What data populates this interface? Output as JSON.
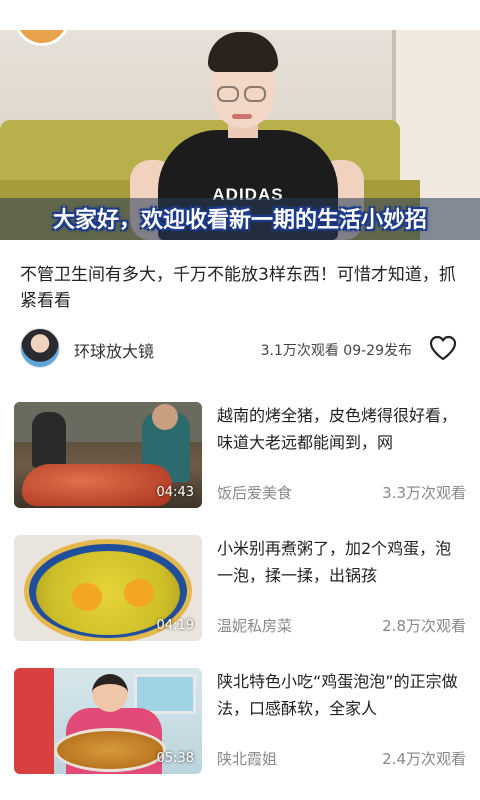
{
  "player": {
    "subtitle": "大家好，欢迎收看新一期的生活小妙招",
    "shirt_text": "ADIDAS",
    "progress_percent": 0
  },
  "video": {
    "title": "不管卫生间有多大，千万不能放3样东西！可惜才知道，抓紧看看",
    "author": "环球放大镜",
    "view_info": "3.1万次观看 09-29发布",
    "like_icon": "heart-outline-icon"
  },
  "recommendations": [
    {
      "title": "越南的烤全猪，皮色烤得很好看，味道大老远都能闻到，网",
      "duration": "04:43",
      "author": "饭后爱美食",
      "views": "3.3万次观看"
    },
    {
      "title": "小米别再煮粥了，加2个鸡蛋，泡一泡，揉一揉，出锅孩",
      "duration": "04:19",
      "author": "温妮私房菜",
      "views": "2.8万次观看"
    },
    {
      "title": "陕北特色小吃“鸡蛋泡泡”的正宗做法，口感酥软，全家人",
      "duration": "05:38",
      "author": "陕北霞姐",
      "views": "2.4万次观看"
    }
  ],
  "colors": {
    "accent_red": "#e23c2e",
    "meta_gray": "#888888",
    "subtitle_outline": "#1d3a8a"
  }
}
